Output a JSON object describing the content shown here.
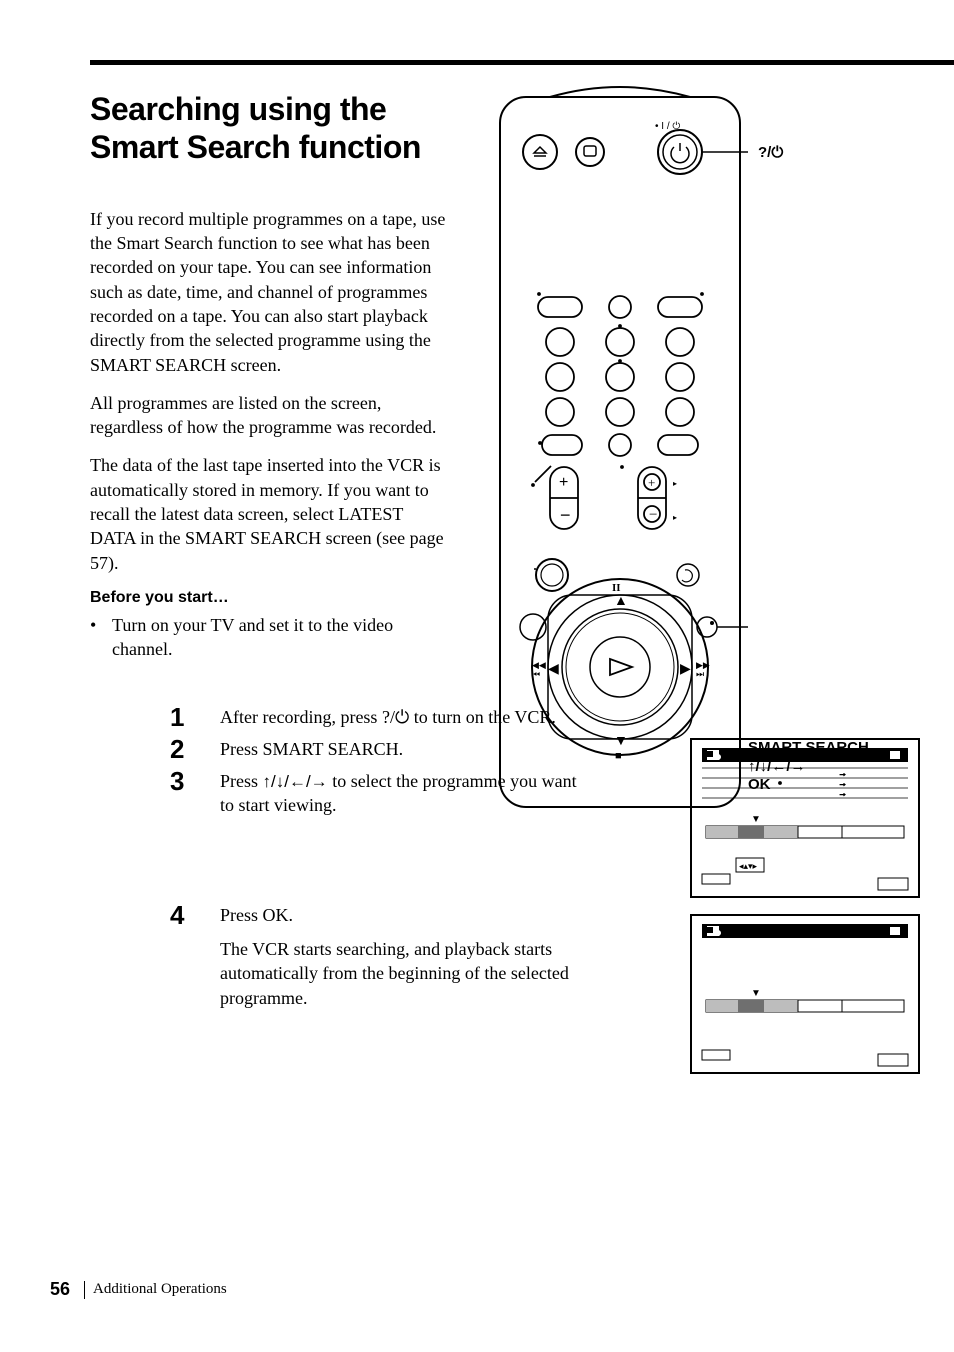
{
  "heading": "Searching using the Smart Search function",
  "para1": "If you record multiple programmes on a tape, use the Smart Search function to see what has been recorded on your tape. You can see information such as date, time, and channel of programmes recorded on a tape. You can also start playback directly from the selected programme using the SMART SEARCH screen.",
  "para2": "All programmes are listed on the screen, regardless of how the programme was recorded.",
  "para3": "The data of the last tape inserted into the VCR is automatically stored in memory. If you want to recall the latest data screen, select LATEST DATA in the SMART SEARCH screen (see page 57).",
  "before_start_label": "Before you start…",
  "bullet1": "Turn on your TV and set it to the video channel.",
  "callout_power_label": "?/1",
  "callout_smart_label": "SMART SEARCH",
  "callout_arrows_label": "M/m/</,",
  "callout_ok_label": "OK",
  "steps": {
    "s1_num": "1",
    "s1_text_a": "After recording, press ",
    "s1_text_b": " to turn on the VCR.",
    "s2_num": "2",
    "s2_text": "Press SMART SEARCH.",
    "s3_num": "3",
    "s3_text_a": "Press ",
    "s3_text_b": " to select the programme you want to start viewing.",
    "s4_num": "4",
    "s4_text": "Press OK.",
    "s4_para": "The VCR starts searching, and playback starts automatically from the beginning of the selected programme."
  },
  "footer": {
    "page_num": "56",
    "section": "Additional Operations"
  }
}
